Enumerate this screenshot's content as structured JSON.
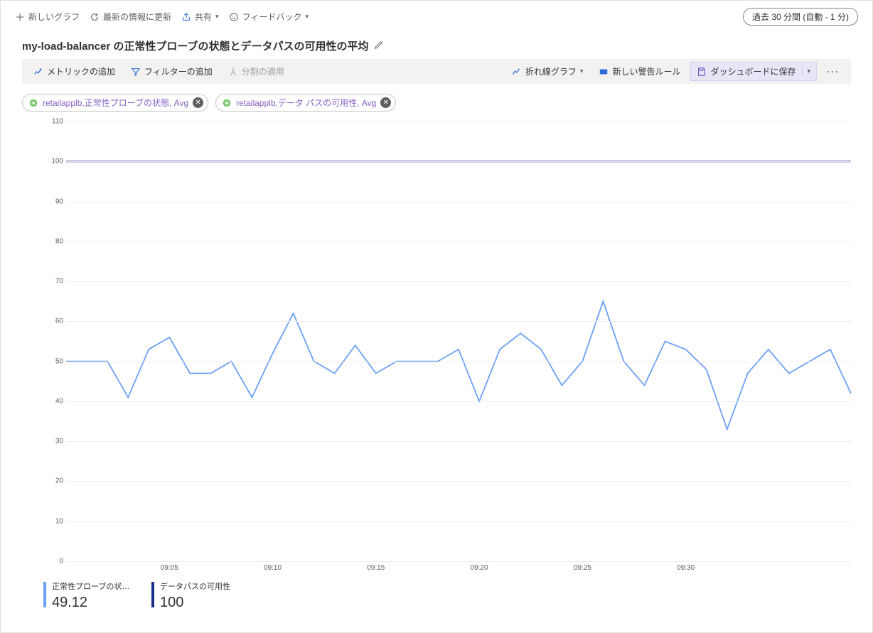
{
  "topbar": {
    "new_chart": "新しいグラフ",
    "refresh": "最新の情報に更新",
    "share": "共有",
    "feedback": "フィードバック",
    "time_range": "過去 30 分間 (自動 - 1 分)"
  },
  "title": "my-load-balancer の正常性プローブの状態とデータパスの可用性の平均",
  "toolbar": {
    "add_metric": "メトリックの追加",
    "add_filter": "フィルターの追加",
    "apply_split": "分割の適用",
    "chart_type": "折れ線グラフ",
    "new_alert": "新しい警告ルール",
    "save_dashboard": "ダッシュボードに保存"
  },
  "pills": [
    {
      "label": "retailapplb,正常性プローブの状態, Avg"
    },
    {
      "label": "retailapplb,データ パスの可用性, Avg"
    }
  ],
  "legend": [
    {
      "name": "正常性プローブの状態...",
      "value": "49.12",
      "color": "#6ca0f5"
    },
    {
      "name": "データパスの可用性",
      "value": "100",
      "color": "#1b2f8a"
    }
  ],
  "colors": {
    "series1": "#6ca0f5",
    "series2": "#1b2f8a"
  },
  "chart_data": {
    "type": "line",
    "title": "my-load-balancer の正常性プローブの状態とデータパスの可用性の平均",
    "xlabel": "",
    "ylabel": "",
    "ylim": [
      0,
      110
    ],
    "y_ticks": [
      0,
      10,
      20,
      30,
      40,
      50,
      60,
      70,
      80,
      90,
      100,
      110
    ],
    "x_tick_labels": [
      "09:05",
      "09:10",
      "09:15",
      "09:20",
      "09:25",
      "09:30"
    ],
    "x_tick_indices": [
      5,
      10,
      15,
      20,
      25,
      30
    ],
    "series": [
      {
        "name": "正常性プローブの状態 (Avg)",
        "color": "#6ca0f5",
        "values": [
          50,
          50,
          50,
          41,
          53,
          56,
          47,
          47,
          50,
          41,
          52,
          62,
          50,
          47,
          54,
          47,
          50,
          50,
          50,
          53,
          40,
          53,
          57,
          53,
          44,
          50,
          65,
          50,
          44,
          55,
          53,
          48,
          33,
          47,
          53,
          47,
          50,
          53,
          42
        ]
      },
      {
        "name": "データ パスの可用性 (Avg)",
        "color": "#1b2f8a",
        "values": [
          100,
          100,
          100,
          100,
          100,
          100,
          100,
          100,
          100,
          100,
          100,
          100,
          100,
          100,
          100,
          100,
          100,
          100,
          100,
          100,
          100,
          100,
          100,
          100,
          100,
          100,
          100,
          100,
          100,
          100,
          100,
          100,
          100,
          100,
          100,
          100,
          100,
          100,
          100
        ]
      }
    ]
  }
}
